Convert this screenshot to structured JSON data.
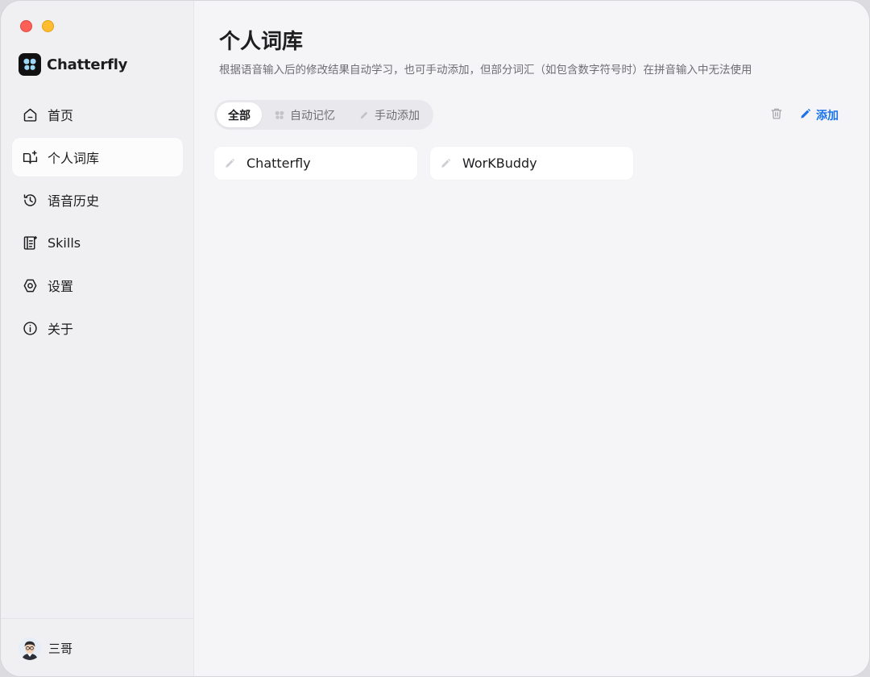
{
  "app": {
    "name": "Chatterfly"
  },
  "sidebar": {
    "items": [
      {
        "label": "首页",
        "icon": "home-icon"
      },
      {
        "label": "个人词库",
        "icon": "book-sparkle-icon",
        "active": true
      },
      {
        "label": "语音历史",
        "icon": "history-icon"
      },
      {
        "label": "Skills",
        "icon": "skills-list-icon"
      },
      {
        "label": "设置",
        "icon": "settings-hexagon-icon"
      },
      {
        "label": "关于",
        "icon": "info-icon"
      }
    ],
    "user": {
      "name": "三哥"
    }
  },
  "main": {
    "title": "个人词库",
    "description": "根据语音输入后的修改结果自动学习，也可手动添加，但部分词汇（如包含数字符号时）在拼音输入中无法使用",
    "tabs": [
      {
        "label": "全部",
        "active": true
      },
      {
        "label": "自动记忆",
        "icon": "butterfly-icon"
      },
      {
        "label": "手动添加",
        "icon": "pencil-icon"
      }
    ],
    "add_label": "添加",
    "words": [
      {
        "text": "Chatterfly"
      },
      {
        "text": "WorKBuddy"
      }
    ]
  },
  "colors": {
    "accent": "#1a73e8",
    "sidebar_bg": "#f0f0f3",
    "main_bg": "#f5f5f8",
    "traffic_red": "#fe5f57",
    "traffic_yellow": "#febc2e"
  }
}
